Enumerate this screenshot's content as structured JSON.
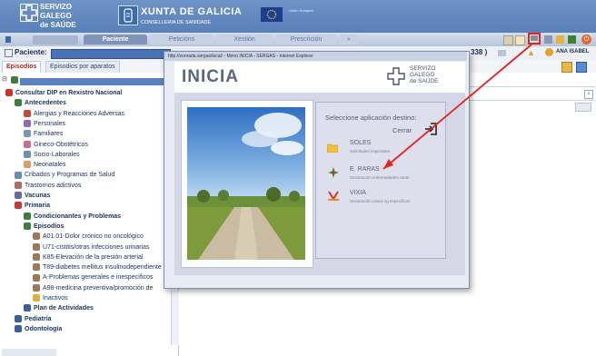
{
  "banner": {
    "servizo": [
      "SERVIZO",
      "GALEGO",
      "de SAÚDE"
    ],
    "xunta": "XUNTA DE GALICIA",
    "consellaria": "CONSELLERIA DE SANIDADE",
    "eu_text": "Unión Europea"
  },
  "nav": {
    "tabs": [
      {
        "label": "Paciente"
      },
      {
        "label": "Peticións"
      },
      {
        "label": "Xestión"
      },
      {
        "label": "Prescrición"
      }
    ]
  },
  "patient_bar": {
    "label": "Paciente:",
    "id_suffix": "338 )",
    "user": "ANA ISABEL"
  },
  "tabs": [
    {
      "label": "Episodios"
    },
    {
      "label": "Episodios por aparatos"
    }
  ],
  "tree": {
    "items": [
      {
        "label": "Consultar DIP en Rexistro Nacional",
        "bold": true,
        "indent": 0,
        "color": "#c4362f"
      },
      {
        "label": "Antecedentes",
        "bold": true,
        "indent": 1,
        "color": "#3e7f3a"
      },
      {
        "label": "Alergias y Reacciones Adversas",
        "bold": false,
        "indent": 2,
        "color": "#c44a3a"
      },
      {
        "label": "Personales",
        "bold": false,
        "indent": 2,
        "color": "#8a6bb8"
      },
      {
        "label": "Familiares",
        "bold": false,
        "indent": 2,
        "color": "#7b94b5"
      },
      {
        "label": "Gineco-Obstétricos",
        "bold": false,
        "indent": 2,
        "color": "#cf6a8f"
      },
      {
        "label": "Socio-Laborales",
        "bold": false,
        "indent": 2,
        "color": "#6f8fb0"
      },
      {
        "label": "Neonatales",
        "bold": false,
        "indent": 2,
        "color": "#e39a6a"
      },
      {
        "label": "Cribados y Programas de Salud",
        "bold": false,
        "indent": 1,
        "color": "#6a8ab0"
      },
      {
        "label": "Trastornos adictivos",
        "bold": false,
        "indent": 1,
        "color": "#b06a6a"
      },
      {
        "label": "Vacunas",
        "bold": true,
        "indent": 1,
        "color": "#6a6aa0"
      },
      {
        "label": "Primaria",
        "bold": true,
        "indent": 1,
        "color": "#c43a3a"
      },
      {
        "label": "Condicionantes y Problemas",
        "bold": true,
        "indent": 2,
        "color": "#3a7f3a"
      },
      {
        "label": "Episodios",
        "bold": true,
        "indent": 2,
        "color": "#3a7f3a"
      },
      {
        "label": "A01.01-Dolor crónico no oncológico",
        "bold": false,
        "indent": 3,
        "color": "#9a7a5a"
      },
      {
        "label": "U71-cistitis/otras infecciones urinarias",
        "bold": false,
        "indent": 3,
        "color": "#9a7a5a"
      },
      {
        "label": "K85-Elevación de la presión arterial",
        "bold": false,
        "indent": 3,
        "color": "#9a7a5a"
      },
      {
        "label": "T89-diabetes mellitus insulinodependiente",
        "bold": false,
        "indent": 3,
        "color": "#9a7a5a"
      },
      {
        "label": "A-Problemas generales e inespecíficos",
        "bold": false,
        "indent": 3,
        "color": "#9a7a5a"
      },
      {
        "label": "A98-medicina preventiva/promoción de",
        "bold": false,
        "indent": 3,
        "color": "#9a7a5a"
      },
      {
        "label": "Inactivos",
        "bold": false,
        "indent": 3,
        "color": "#d4b24a"
      },
      {
        "label": "Plan de Actividades",
        "bold": true,
        "indent": 2,
        "color": "#3a5f9a"
      },
      {
        "label": "Pediatría",
        "bold": true,
        "indent": 1,
        "color": "#3a5f9a"
      },
      {
        "label": "Odontología",
        "bold": true,
        "indent": 1,
        "color": "#3a5f9a"
      }
    ]
  },
  "modal": {
    "titlebar": "http://xornada.sergas/local/ - Menú INICIA - SERGAS - Internet Explorer",
    "title": "INICIA",
    "logo": [
      "SERVIZO",
      "GALEGO",
      "de SAÚDE"
    ],
    "select_label": "Seleccione aplicación destino:",
    "cerrar": "Cerrar",
    "apps": [
      {
        "name": "SOLES",
        "desc": "Solicitudes especiales"
      },
      {
        "name": "E. RARAS",
        "desc": "Declaración enfermedades raras"
      },
      {
        "name": "VIXIA",
        "desc": "Declaración casos xg específicos"
      }
    ]
  },
  "colors": {
    "banner": "#5a80b8",
    "arrow": "#e0241e",
    "accent_red": "#b8211b"
  }
}
